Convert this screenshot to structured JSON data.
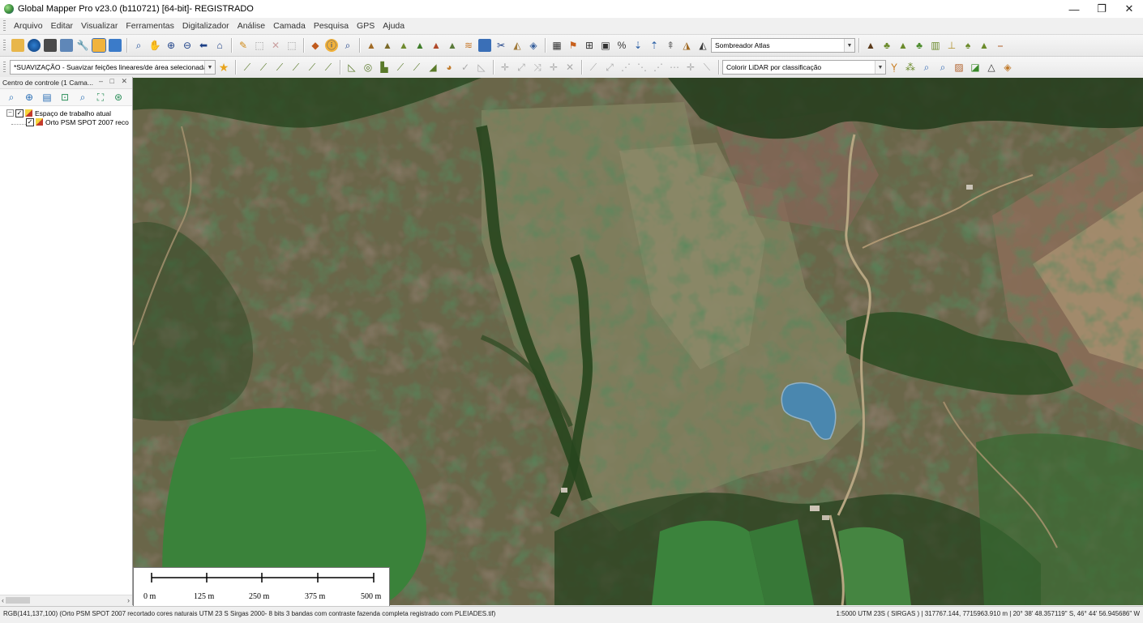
{
  "window": {
    "title": "Global Mapper Pro v23.0 (b110721) [64-bit]- REGISTRADO",
    "minimize": "—",
    "maximize": "❐",
    "close": "✕"
  },
  "menu": [
    "Arquivo",
    "Editar",
    "Visualizar",
    "Ferramentas",
    "Digitalizador",
    "Análise",
    "Camada",
    "Pesquisa",
    "GPS",
    "Ajuda"
  ],
  "toolbar1": {
    "shader_select": "Sombreador Atlas"
  },
  "toolbar2": {
    "smoothing_select": "*SUAVIZAÇÃO - Suavizar feições lineares/de área selecionadas",
    "lidar_select": "Colorir LiDAR por classificação"
  },
  "control_center": {
    "title": "Centro de controle (1 Cama...",
    "window_controls": "– □ ✕",
    "layers": [
      {
        "label": "Espaço de trabalho atual",
        "checked": true,
        "level": 0
      },
      {
        "label": "Orto PSM SPOT 2007 reco",
        "checked": true,
        "level": 1
      }
    ],
    "scroll_left": "‹",
    "scroll_right": "›"
  },
  "scale_bar": {
    "labels": [
      "0 m",
      "125 m",
      "250 m",
      "375 m",
      "500 m"
    ]
  },
  "status": {
    "left": "RGB(141,137,100) (Orto PSM SPOT 2007 recortado cores naturais UTM 23 S Sirgas 2000- 8 bits 3 bandas com contraste fazenda completa registrado com PLEIADES.tif)",
    "right": "1:5000  UTM 23S ( SIRGAS ) | 317767.144, 7715963.910 m | 20° 38' 48.357119\" S, 46° 44' 56.945686\" W"
  },
  "icons": {
    "toolbar1": [
      "open-folder-icon",
      "globe-icon",
      "save-icon",
      "export-icon",
      "wrench-icon",
      "layers-icon",
      "overlay-icon",
      "zoom-tool-icon",
      "pan-icon",
      "zoom-in-icon",
      "zoom-out-icon",
      "back-icon",
      "home-icon",
      "pencil-icon",
      "select-icon",
      "delete-icon",
      "digitize-icon",
      "measure-icon",
      "info-icon",
      "search-icon",
      "terrain-icon",
      "terrain-2-icon",
      "terrain-3-icon",
      "terrain-4-icon",
      "terrain-5-icon",
      "terrain-6-icon",
      "contour-icon",
      "image-icon",
      "cut-icon",
      "profile-icon",
      "view3d-icon",
      "grid-icon",
      "flag-icon",
      "insert-icon",
      "clip-icon",
      "percent-icon",
      "elev-icon",
      "elev-2-icon",
      "elev-3-icon",
      "elev-4-icon",
      "shader-icon",
      "mountain-icon",
      "tree-icon",
      "mountain-2-icon",
      "tree-2-icon",
      "building-icon",
      "tower-icon",
      "tree-3-icon",
      "lidar-icon",
      "line-icon"
    ],
    "toolbar2": [
      "favorite-star-icon",
      "line-edit-icon",
      "line-edit-2-icon",
      "line-edit-3-icon",
      "line-edit-4-icon",
      "line-edit-5-icon",
      "line-edit-6-icon",
      "area-edit-icon",
      "circle-icon",
      "area-edit-2-icon",
      "area-edit-3-icon",
      "area-edit-4-icon",
      "area-edit-5-icon",
      "area-edit-6-icon",
      "check-icon",
      "check-2-icon",
      "move-icon",
      "move-2-icon",
      "move-3-icon",
      "move-4-icon",
      "move-5-icon",
      "line-tool-icon",
      "line-tool-2-icon",
      "line-tool-3-icon",
      "line-tool-4-icon",
      "line-tool-5-icon",
      "line-tool-6-icon",
      "line-tool-7-icon",
      "ruler-icon",
      "filter-icon",
      "lidar-2-icon",
      "lidar-3-icon",
      "lidar-4-icon",
      "lidar-5-icon",
      "lidar-6-icon",
      "triangle-icon",
      "lidar-7-icon"
    ],
    "panel_tools": [
      "zoom-layer-icon",
      "globe-layer-icon",
      "grid-layer-icon",
      "tool-layer-icon",
      "zoom-layer-2-icon",
      "tool-layer-2-icon",
      "tool-layer-3-icon"
    ]
  }
}
